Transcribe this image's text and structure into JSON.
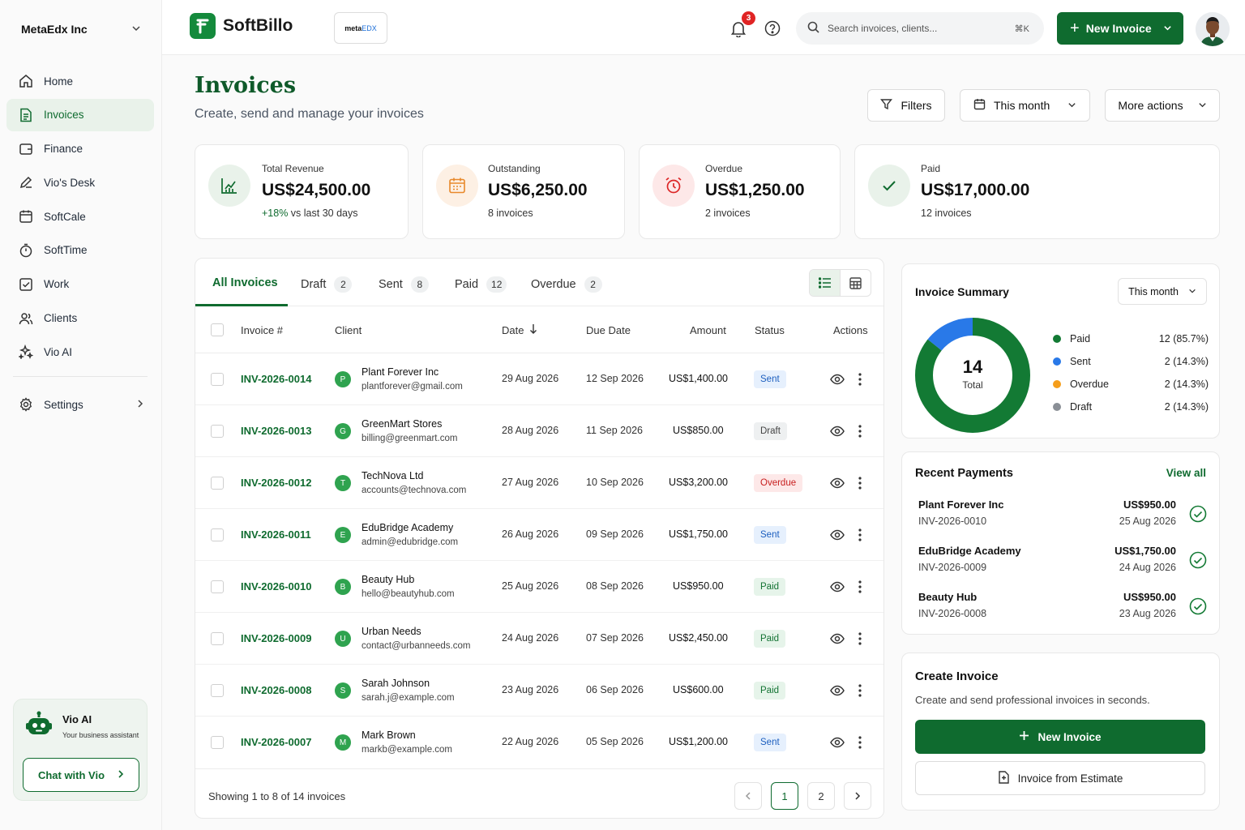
{
  "org": {
    "name": "MetaEdx Inc"
  },
  "nav": {
    "items": [
      {
        "label": "Home",
        "icon": "home-icon"
      },
      {
        "label": "Invoices",
        "icon": "invoice-icon",
        "active": true
      },
      {
        "label": "Finance",
        "icon": "wallet-icon"
      },
      {
        "label": "Vio's Desk",
        "icon": "pen-icon"
      },
      {
        "label": "SoftCale",
        "icon": "calendar-icon"
      },
      {
        "label": "SoftTime",
        "icon": "stopwatch-icon"
      },
      {
        "label": "Work",
        "icon": "checkbox-icon"
      },
      {
        "label": "Clients",
        "icon": "users-icon"
      },
      {
        "label": "Vio AI",
        "icon": "sparkles-icon"
      }
    ],
    "settings_label": "Settings"
  },
  "vio_card": {
    "title": "Vio AI",
    "subtitle": "Your business assistant",
    "button": "Chat with Vio"
  },
  "topbar": {
    "brand": "SoftBillo",
    "company_badge_a": "meta",
    "company_badge_b": "EDX",
    "notifications": "3",
    "search_placeholder": "Search invoices, clients...",
    "search_shortcut": "⌘K",
    "new_invoice": "New Invoice"
  },
  "page": {
    "title": "Invoices",
    "subtitle": "Create, send and manage your invoices",
    "filters": "Filters",
    "period": "This month",
    "more": "More actions"
  },
  "stats": [
    {
      "label": "Total Revenue",
      "value": "US$24,500.00",
      "sub_highlight": "+18%",
      "sub": " vs last 30 days",
      "color": "#e9f2ea"
    },
    {
      "label": "Outstanding",
      "value": "US$6,250.00",
      "sub_highlight": "",
      "sub": "8 invoices",
      "color": "#fdf0e4"
    },
    {
      "label": "Overdue",
      "value": "US$1,250.00",
      "sub_highlight": "",
      "sub": "2 invoices",
      "color": "#fde8e8"
    },
    {
      "label": "Paid",
      "value": "US$17,000.00",
      "sub_highlight": "",
      "sub": "12 invoices",
      "color": "#e9f2ea"
    }
  ],
  "tabs": [
    {
      "label": "All Invoices",
      "count": ""
    },
    {
      "label": "Draft",
      "count": "2"
    },
    {
      "label": "Sent",
      "count": "8"
    },
    {
      "label": "Paid",
      "count": "12"
    },
    {
      "label": "Overdue",
      "count": "2"
    }
  ],
  "table": {
    "columns": [
      "Invoice #",
      "Client",
      "Date",
      "Due Date",
      "Amount",
      "Status",
      "Actions"
    ],
    "rows": [
      {
        "id": "INV-2026-0014",
        "initial": "P",
        "client": "Plant Forever Inc",
        "email": "plantforever@gmail.com",
        "date": "29 Aug 2026",
        "due": "12 Sep 2026",
        "amount": "US$1,400.00",
        "status": "Sent"
      },
      {
        "id": "INV-2026-0013",
        "initial": "G",
        "client": "GreenMart Stores",
        "email": "billing@greenmart.com",
        "date": "28 Aug 2026",
        "due": "11 Sep 2026",
        "amount": "US$850.00",
        "status": "Draft"
      },
      {
        "id": "INV-2026-0012",
        "initial": "T",
        "client": "TechNova Ltd",
        "email": "accounts@technova.com",
        "date": "27 Aug 2026",
        "due": "10 Sep 2026",
        "amount": "US$3,200.00",
        "status": "Overdue"
      },
      {
        "id": "INV-2026-0011",
        "initial": "E",
        "client": "EduBridge Academy",
        "email": "admin@edubridge.com",
        "date": "26 Aug 2026",
        "due": "09 Sep 2026",
        "amount": "US$1,750.00",
        "status": "Sent"
      },
      {
        "id": "INV-2026-0010",
        "initial": "B",
        "client": "Beauty Hub",
        "email": "hello@beautyhub.com",
        "date": "25 Aug 2026",
        "due": "08 Sep 2026",
        "amount": "US$950.00",
        "status": "Paid"
      },
      {
        "id": "INV-2026-0009",
        "initial": "U",
        "client": "Urban Needs",
        "email": "contact@urbanneeds.com",
        "date": "24 Aug 2026",
        "due": "07 Sep 2026",
        "amount": "US$2,450.00",
        "status": "Paid"
      },
      {
        "id": "INV-2026-0008",
        "initial": "S",
        "client": "Sarah Johnson",
        "email": "sarah.j@example.com",
        "date": "23 Aug 2026",
        "due": "06 Sep 2026",
        "amount": "US$600.00",
        "status": "Paid"
      },
      {
        "id": "INV-2026-0007",
        "initial": "M",
        "client": "Mark Brown",
        "email": "markb@example.com",
        "date": "22 Aug 2026",
        "due": "05 Sep 2026",
        "amount": "US$1,200.00",
        "status": "Sent"
      }
    ],
    "footer": "Showing 1 to 8 of 14 invoices",
    "pages": [
      "1",
      "2"
    ]
  },
  "summary": {
    "title": "Invoice Summary",
    "period": "This month",
    "total": "14",
    "total_label": "Total",
    "legend": [
      {
        "label": "Paid",
        "value": "12 (85.7%)",
        "color": "#137a34"
      },
      {
        "label": "Sent",
        "value": "2 (14.3%)",
        "color": "#2979e8"
      },
      {
        "label": "Overdue",
        "value": "2 (14.3%)",
        "color": "#f59e1b"
      },
      {
        "label": "Draft",
        "value": "2 (14.3%)",
        "color": "#8a8f96"
      }
    ],
    "donut_segments": [
      {
        "label": "Paid",
        "fraction": 0.857,
        "color": "#137a34"
      },
      {
        "label": "Sent",
        "fraction": 0.143,
        "color": "#2979e8"
      }
    ]
  },
  "recent_payments": {
    "title": "Recent Payments",
    "view_all": "View all",
    "items": [
      {
        "client": "Plant Forever Inc",
        "invoice": "INV-2026-0010",
        "amount": "US$950.00",
        "date": "25 Aug 2026"
      },
      {
        "client": "EduBridge Academy",
        "invoice": "INV-2026-0009",
        "amount": "US$1,750.00",
        "date": "24 Aug 2026"
      },
      {
        "client": "Beauty Hub",
        "invoice": "INV-2026-0008",
        "amount": "US$950.00",
        "date": "23 Aug 2026"
      }
    ]
  },
  "create_invoice": {
    "title": "Create Invoice",
    "subtitle": "Create and send professional invoices in seconds.",
    "primary": "New Invoice",
    "secondary": "Invoice from Estimate"
  }
}
